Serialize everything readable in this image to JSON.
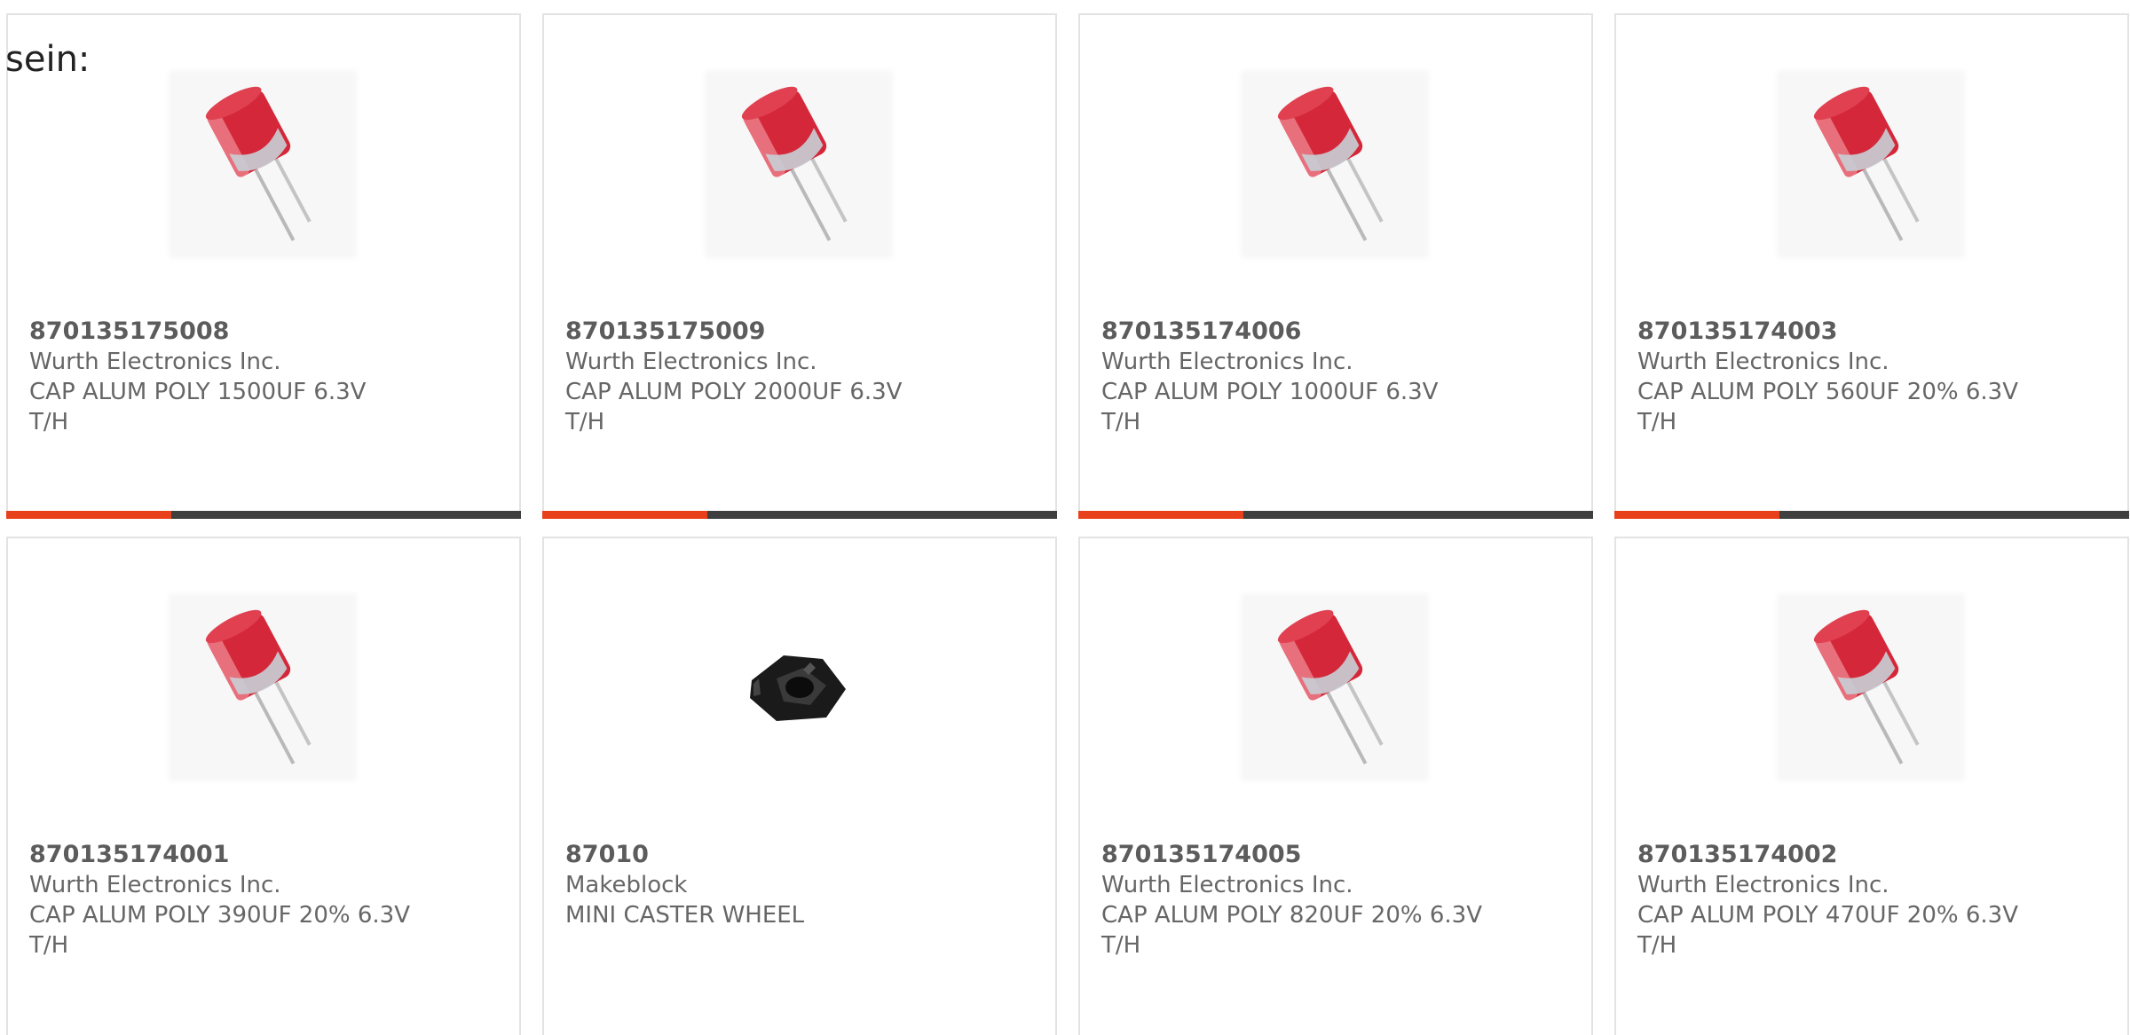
{
  "intro_text": "sein:",
  "colors": {
    "accent": "#e8401a",
    "progress_track": "#3f3f3f",
    "card_border": "#e3e3e3",
    "capacitor_red": "#d4283a",
    "caster_black": "#1a1a1a"
  },
  "products": [
    {
      "part_number": "870135175008",
      "manufacturer": "Wurth Electronics Inc.",
      "description_line1": "CAP ALUM POLY 1500UF 6.3V",
      "description_line2": "T/H",
      "image_icon": "red-capacitor-icon",
      "progress": 0.32
    },
    {
      "part_number": "870135175009",
      "manufacturer": "Wurth Electronics Inc.",
      "description_line1": "CAP ALUM POLY 2000UF 6.3V",
      "description_line2": "T/H",
      "image_icon": "red-capacitor-icon",
      "progress": 0.32
    },
    {
      "part_number": "870135174006",
      "manufacturer": "Wurth Electronics Inc.",
      "description_line1": "CAP ALUM POLY 1000UF 6.3V",
      "description_line2": "T/H",
      "image_icon": "red-capacitor-icon",
      "progress": 0.32
    },
    {
      "part_number": "870135174003",
      "manufacturer": "Wurth Electronics Inc.",
      "description_line1": "CAP ALUM POLY 560UF 20% 6.3V",
      "description_line2": "T/H",
      "image_icon": "red-capacitor-icon",
      "progress": 0.32
    },
    {
      "part_number": "870135174001",
      "manufacturer": "Wurth Electronics Inc.",
      "description_line1": "CAP ALUM POLY 390UF 20% 6.3V",
      "description_line2": "T/H",
      "image_icon": "red-capacitor-icon"
    },
    {
      "part_number": "87010",
      "manufacturer": "Makeblock",
      "description_line1": "MINI CASTER WHEEL",
      "description_line2": "",
      "image_icon": "caster-wheel-icon"
    },
    {
      "part_number": "870135174005",
      "manufacturer": "Wurth Electronics Inc.",
      "description_line1": "CAP ALUM POLY 820UF 20% 6.3V",
      "description_line2": "T/H",
      "image_icon": "red-capacitor-icon"
    },
    {
      "part_number": "870135174002",
      "manufacturer": "Wurth Electronics Inc.",
      "description_line1": "CAP ALUM POLY 470UF 20% 6.3V",
      "description_line2": "T/H",
      "image_icon": "red-capacitor-icon"
    }
  ]
}
